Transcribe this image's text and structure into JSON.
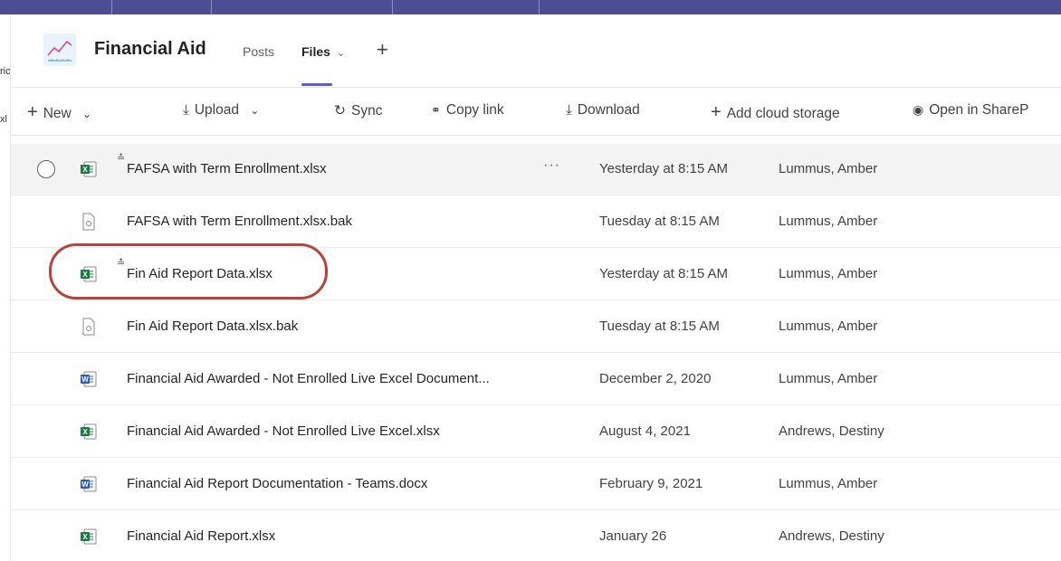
{
  "team": {
    "name": "Financial Aid",
    "tabs": [
      {
        "label": "Posts",
        "active": false
      },
      {
        "label": "Files",
        "active": true,
        "has_dropdown": true
      }
    ],
    "add_tab_icon": "plus-icon"
  },
  "left_strip": [
    "ric",
    "xl"
  ],
  "toolbar": {
    "new_label": "New",
    "upload_label": "Upload",
    "sync_label": "Sync",
    "copy_link_label": "Copy link",
    "download_label": "Download",
    "add_cloud_label": "Add cloud storage",
    "open_sharepoint_label": "Open in ShareP"
  },
  "files": [
    {
      "name": "FAFSA with Term Enrollment.xlsx",
      "type": "excel",
      "modified": "Yesterday at 8:15 AM",
      "modified_by": "Lummus, Amber",
      "syncing": true,
      "hover": true
    },
    {
      "name": "FAFSA with Term Enrollment.xlsx.bak",
      "type": "generic",
      "modified": "Tuesday at 8:15 AM",
      "modified_by": "Lummus, Amber",
      "syncing": false,
      "hover": false
    },
    {
      "name": "Fin Aid Report Data.xlsx",
      "type": "excel",
      "modified": "Yesterday at 8:15 AM",
      "modified_by": "Lummus, Amber",
      "syncing": true,
      "hover": false,
      "highlighted": true
    },
    {
      "name": "Fin Aid Report Data.xlsx.bak",
      "type": "generic",
      "modified": "Tuesday at 8:15 AM",
      "modified_by": "Lummus, Amber",
      "syncing": false,
      "hover": false
    },
    {
      "name": "Financial Aid Awarded - Not Enrolled Live Excel Document...",
      "type": "word",
      "modified": "December 2, 2020",
      "modified_by": "Lummus, Amber",
      "syncing": false,
      "hover": false
    },
    {
      "name": "Financial Aid Awarded - Not Enrolled Live Excel.xlsx",
      "type": "excel",
      "modified": "August 4, 2021",
      "modified_by": "Andrews, Destiny",
      "syncing": false,
      "hover": false
    },
    {
      "name": "Financial Aid Report Documentation - Teams.docx",
      "type": "word",
      "modified": "February 9, 2021",
      "modified_by": "Lummus, Amber",
      "syncing": false,
      "hover": false
    },
    {
      "name": "Financial Aid Report.xlsx",
      "type": "excel",
      "modified": "January 26",
      "modified_by": "Andrews, Destiny",
      "syncing": false,
      "hover": false
    }
  ],
  "colors": {
    "accent": "#5b5fc7",
    "topbar": "#4b4e93",
    "excel_green": "#1d7a45",
    "word_blue": "#2b5cb8",
    "highlight_ring": "#b5443a"
  }
}
